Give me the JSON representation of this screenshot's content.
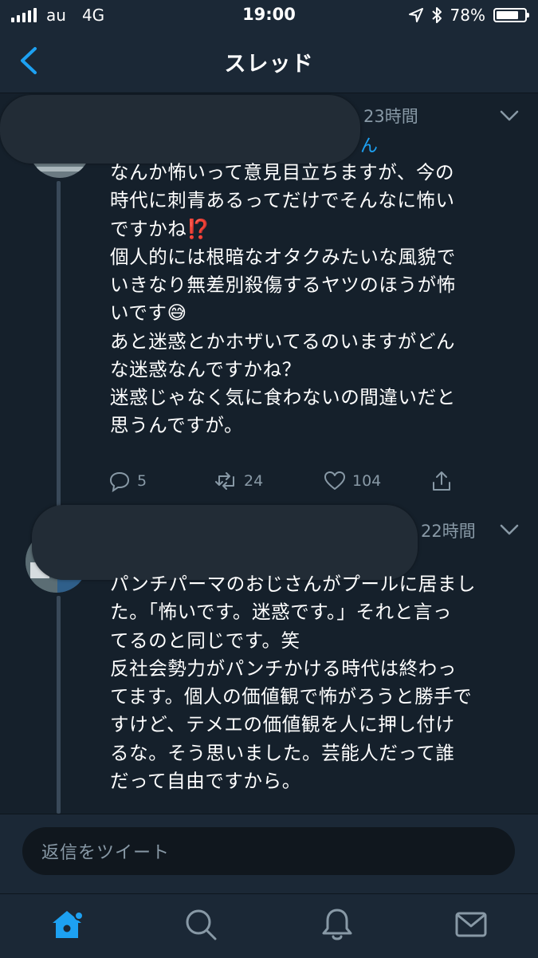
{
  "status_bar": {
    "carrier": "au",
    "network": "4G",
    "time": "19:00",
    "battery": "78%",
    "battery_level": 0.78
  },
  "nav": {
    "title": "スレッド",
    "back_icon": "chevron-left-icon"
  },
  "tweets": [
    {
      "time": "23時間",
      "handle_fragment": "ん",
      "text": "なんか怖いって意見目立ちますが、今の\n時代に刺青あるってだけでそんなに怖い\nですかね⁉️\n個人的には根暗なオタクみたいな風貌で\nいきなり無差別殺傷するヤツのほうが怖\nいです😅\nあと迷惑とかホザいてるのいますがどん\nな迷惑なんですかね？\n迷惑じゃなく気に食わないの間違いだと\n思うんですが。",
      "replies": "5",
      "retweets": "24",
      "likes": "104"
    },
    {
      "time": "22時間",
      "text": "パンチパーマのおじさんがプールに居まし\nた。「怖いです。迷惑です。」それと言っ\nてるのと同じです。笑\n反社会勢力がパンチかける時代は終わっ\nてます。個人の価値観で怖がろうと勝手で\nすけど、テメエの価値観を人に押し付け\nるな。そう思いました。芸能人だって誰\nだって自由ですから。"
    }
  ],
  "reply_bar": {
    "placeholder": "返信をツイート"
  },
  "tabs": [
    "home-icon",
    "search-icon",
    "notifications-icon",
    "messages-icon"
  ],
  "colors": {
    "background": "#15202b",
    "accent": "#1da1f2",
    "muted": "#8899a6"
  }
}
